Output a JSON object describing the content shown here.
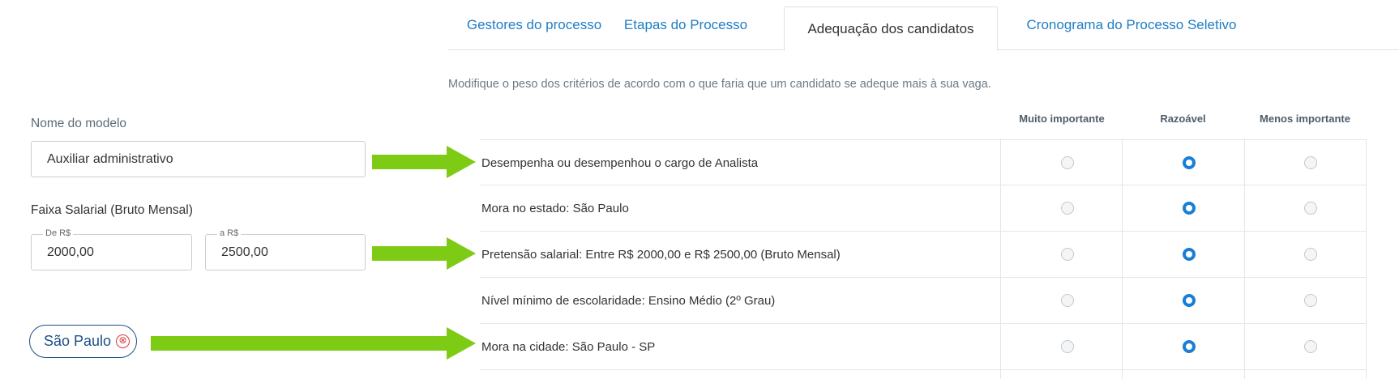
{
  "tabs": [
    {
      "label": "Gestores do processo"
    },
    {
      "label": "Etapas do Processo"
    },
    {
      "label": "Adequação dos candidatos",
      "active": true
    },
    {
      "label": "Cronograma do Processo Seletivo"
    }
  ],
  "description": "Modifique o peso dos critérios de acordo com o que faria que um candidato se adeque mais à sua vaga.",
  "form": {
    "model_label": "Nome do modelo",
    "model_value": "Auxiliar administrativo",
    "salary_label": "Faixa Salarial (Bruto Mensal)",
    "salary_from_legend": "De R$",
    "salary_from_value": "2000,00",
    "salary_to_legend": "a R$",
    "salary_to_value": "2500,00"
  },
  "location_chip": {
    "label": "São Paulo",
    "remove_glyph": "⊗"
  },
  "criteria": {
    "columns": [
      "Muito importante",
      "Razoável",
      "Menos importante"
    ],
    "rows": [
      {
        "label": "Desempenha ou desempenhou o cargo de Analista",
        "selected": "Razoável"
      },
      {
        "label": "Mora no estado: São Paulo",
        "selected": "Razoável"
      },
      {
        "label": "Pretensão salarial: Entre R$ 2000,00 e R$ 2500,00 (Bruto Mensal)",
        "selected": "Razoável"
      },
      {
        "label": "Nível mínimo de escolaridade: Ensino Médio (2º Grau)",
        "selected": "Razoável"
      },
      {
        "label": "Mora na cidade: São Paulo - SP",
        "selected": "Razoável"
      }
    ]
  },
  "colors": {
    "accent": "#1a7fd4",
    "tab_link": "#1f7ec4",
    "arrow": "#7dcb14",
    "chip_border": "#1d4f86",
    "chip_remove": "#e0343a"
  },
  "icons": {
    "arrow": "right-arrow-icon",
    "chip_remove": "close-circle-icon"
  }
}
